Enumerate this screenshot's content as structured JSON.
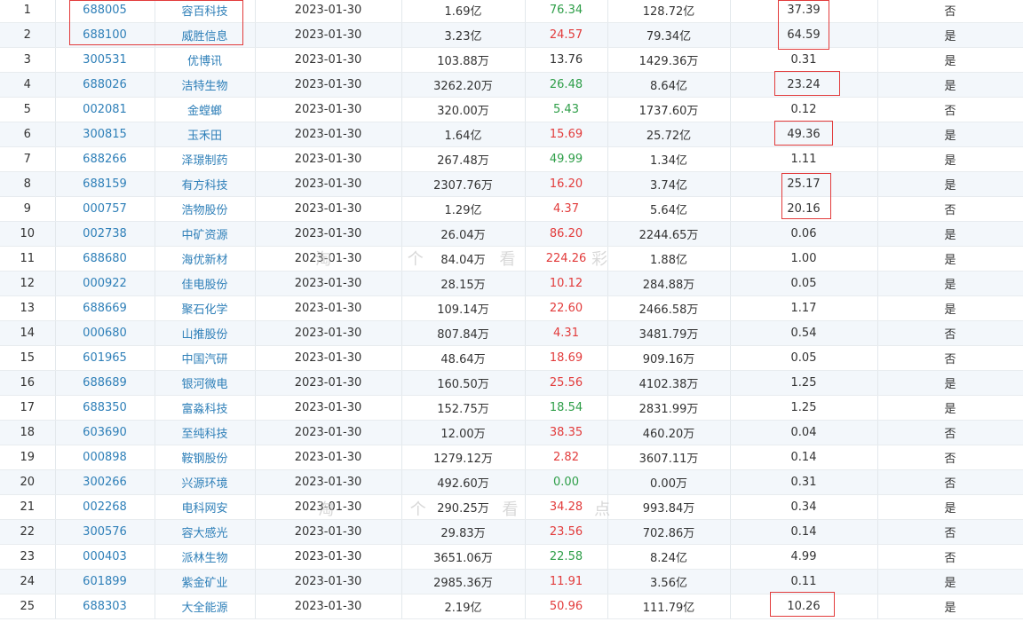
{
  "table": {
    "rows": [
      {
        "idx": "1",
        "code": "688005",
        "name": "容百科技",
        "date": "2023-01-30",
        "amount": "1.69亿",
        "ratio": "76.34",
        "ratio_color": "down",
        "cap": "128.72亿",
        "pct": "37.39",
        "flag": "否"
      },
      {
        "idx": "2",
        "code": "688100",
        "name": "威胜信息",
        "date": "2023-01-30",
        "amount": "3.23亿",
        "ratio": "24.57",
        "ratio_color": "up",
        "cap": "79.34亿",
        "pct": "64.59",
        "flag": "是"
      },
      {
        "idx": "3",
        "code": "300531",
        "name": "优博讯",
        "date": "2023-01-30",
        "amount": "103.88万",
        "ratio": "13.76",
        "ratio_color": "none",
        "cap": "1429.36万",
        "pct": "0.31",
        "flag": "是"
      },
      {
        "idx": "4",
        "code": "688026",
        "name": "洁特生物",
        "date": "2023-01-30",
        "amount": "3262.20万",
        "ratio": "26.48",
        "ratio_color": "down",
        "cap": "8.64亿",
        "pct": "23.24",
        "flag": "是"
      },
      {
        "idx": "5",
        "code": "002081",
        "name": "金螳螂",
        "date": "2023-01-30",
        "amount": "320.00万",
        "ratio": "5.43",
        "ratio_color": "down",
        "cap": "1737.60万",
        "pct": "0.12",
        "flag": "否"
      },
      {
        "idx": "6",
        "code": "300815",
        "name": "玉禾田",
        "date": "2023-01-30",
        "amount": "1.64亿",
        "ratio": "15.69",
        "ratio_color": "up",
        "cap": "25.72亿",
        "pct": "49.36",
        "flag": "是"
      },
      {
        "idx": "7",
        "code": "688266",
        "name": "泽璟制药",
        "date": "2023-01-30",
        "amount": "267.48万",
        "ratio": "49.99",
        "ratio_color": "down",
        "cap": "1.34亿",
        "pct": "1.11",
        "flag": "是"
      },
      {
        "idx": "8",
        "code": "688159",
        "name": "有方科技",
        "date": "2023-01-30",
        "amount": "2307.76万",
        "ratio": "16.20",
        "ratio_color": "up",
        "cap": "3.74亿",
        "pct": "25.17",
        "flag": "是"
      },
      {
        "idx": "9",
        "code": "000757",
        "name": "浩物股份",
        "date": "2023-01-30",
        "amount": "1.29亿",
        "ratio": "4.37",
        "ratio_color": "up",
        "cap": "5.64亿",
        "pct": "20.16",
        "flag": "否"
      },
      {
        "idx": "10",
        "code": "002738",
        "name": "中矿资源",
        "date": "2023-01-30",
        "amount": "26.04万",
        "ratio": "86.20",
        "ratio_color": "up",
        "cap": "2244.65万",
        "pct": "0.06",
        "flag": "是"
      },
      {
        "idx": "11",
        "code": "688680",
        "name": "海优新材",
        "date": "2023-01-30",
        "amount": "84.04万",
        "ratio": "224.26",
        "ratio_color": "up",
        "cap": "1.88亿",
        "pct": "1.00",
        "flag": "是"
      },
      {
        "idx": "12",
        "code": "000922",
        "name": "佳电股份",
        "date": "2023-01-30",
        "amount": "28.15万",
        "ratio": "10.12",
        "ratio_color": "up",
        "cap": "284.88万",
        "pct": "0.05",
        "flag": "是"
      },
      {
        "idx": "13",
        "code": "688669",
        "name": "聚石化学",
        "date": "2023-01-30",
        "amount": "109.14万",
        "ratio": "22.60",
        "ratio_color": "up",
        "cap": "2466.58万",
        "pct": "1.17",
        "flag": "是"
      },
      {
        "idx": "14",
        "code": "000680",
        "name": "山推股份",
        "date": "2023-01-30",
        "amount": "807.84万",
        "ratio": "4.31",
        "ratio_color": "up",
        "cap": "3481.79万",
        "pct": "0.54",
        "flag": "否"
      },
      {
        "idx": "15",
        "code": "601965",
        "name": "中国汽研",
        "date": "2023-01-30",
        "amount": "48.64万",
        "ratio": "18.69",
        "ratio_color": "up",
        "cap": "909.16万",
        "pct": "0.05",
        "flag": "否"
      },
      {
        "idx": "16",
        "code": "688689",
        "name": "银河微电",
        "date": "2023-01-30",
        "amount": "160.50万",
        "ratio": "25.56",
        "ratio_color": "up",
        "cap": "4102.38万",
        "pct": "1.25",
        "flag": "是"
      },
      {
        "idx": "17",
        "code": "688350",
        "name": "富淼科技",
        "date": "2023-01-30",
        "amount": "152.75万",
        "ratio": "18.54",
        "ratio_color": "down",
        "cap": "2831.99万",
        "pct": "1.25",
        "flag": "是"
      },
      {
        "idx": "18",
        "code": "603690",
        "name": "至纯科技",
        "date": "2023-01-30",
        "amount": "12.00万",
        "ratio": "38.35",
        "ratio_color": "up",
        "cap": "460.20万",
        "pct": "0.04",
        "flag": "否"
      },
      {
        "idx": "19",
        "code": "000898",
        "name": "鞍钢股份",
        "date": "2023-01-30",
        "amount": "1279.12万",
        "ratio": "2.82",
        "ratio_color": "up",
        "cap": "3607.11万",
        "pct": "0.14",
        "flag": "否"
      },
      {
        "idx": "20",
        "code": "300266",
        "name": "兴源环境",
        "date": "2023-01-30",
        "amount": "492.60万",
        "ratio": "0.00",
        "ratio_color": "down",
        "cap": "0.00万",
        "pct": "0.31",
        "flag": "否"
      },
      {
        "idx": "21",
        "code": "002268",
        "name": "电科网安",
        "date": "2023-01-30",
        "amount": "290.25万",
        "ratio": "34.28",
        "ratio_color": "up",
        "cap": "993.84万",
        "pct": "0.34",
        "flag": "是"
      },
      {
        "idx": "22",
        "code": "300576",
        "name": "容大感光",
        "date": "2023-01-30",
        "amount": "29.83万",
        "ratio": "23.56",
        "ratio_color": "up",
        "cap": "702.86万",
        "pct": "0.14",
        "flag": "否"
      },
      {
        "idx": "23",
        "code": "000403",
        "name": "派林生物",
        "date": "2023-01-30",
        "amount": "3651.06万",
        "ratio": "22.58",
        "ratio_color": "down",
        "cap": "8.24亿",
        "pct": "4.99",
        "flag": "否"
      },
      {
        "idx": "24",
        "code": "601899",
        "name": "紫金矿业",
        "date": "2023-01-30",
        "amount": "2985.36万",
        "ratio": "11.91",
        "ratio_color": "up",
        "cap": "3.56亿",
        "pct": "0.11",
        "flag": "是"
      },
      {
        "idx": "25",
        "code": "688303",
        "name": "大全能源",
        "date": "2023-01-30",
        "amount": "2.19亿",
        "ratio": "50.96",
        "ratio_color": "up",
        "cap": "111.79亿",
        "pct": "10.26",
        "flag": "是"
      }
    ]
  },
  "colors": {
    "link": "#2e7fb8",
    "up": "#e23b3b",
    "down": "#2e9e48",
    "highlight": "#e23b3b"
  },
  "watermark": {
    "text_1": "淘 个 看 彩",
    "text_2": "淘 个 看 点"
  }
}
